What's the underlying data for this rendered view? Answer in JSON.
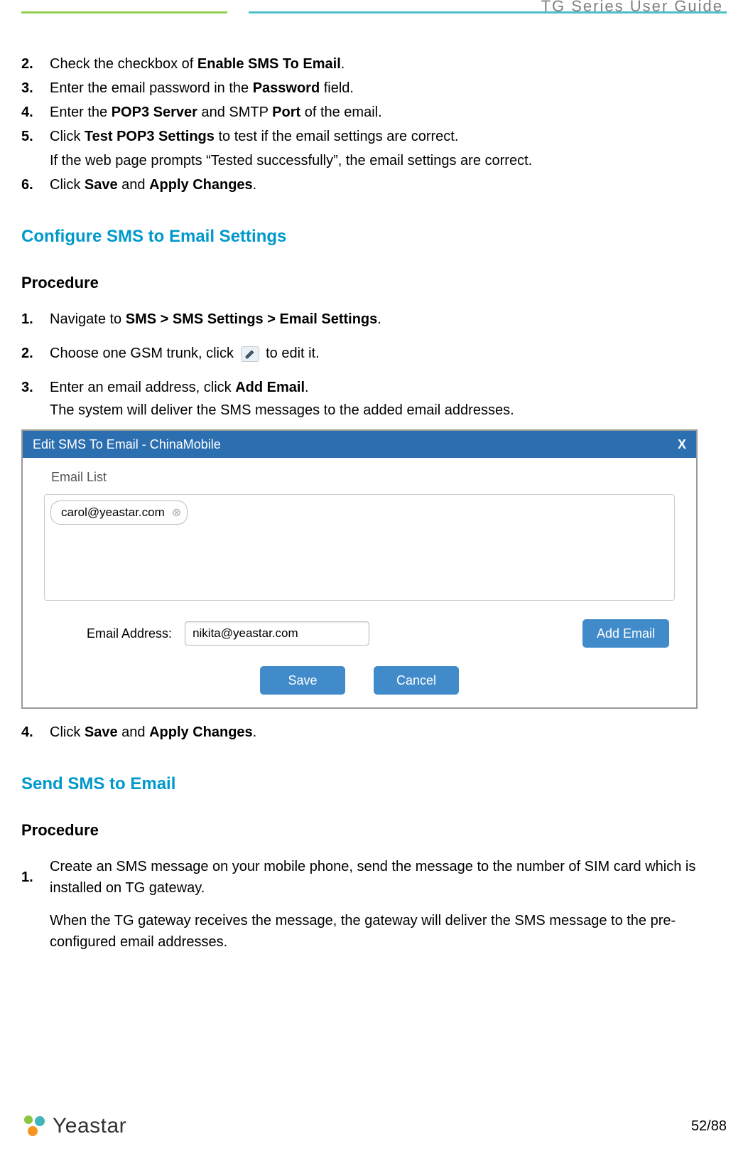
{
  "header": {
    "title": "TG  Series  User  Guide"
  },
  "list1": {
    "item2_a": "Check the checkbox of ",
    "item2_b": "Enable SMS To Email",
    "item2_c": ".",
    "item3_a": "Enter the email password in the ",
    "item3_b": "Password",
    "item3_c": " field.",
    "item4_a": "Enter the ",
    "item4_b": "POP3 Server",
    "item4_c": " and SMTP ",
    "item4_d": "Port",
    "item4_e": " of the email.",
    "item5_a": "Click ",
    "item5_b": "Test POP3 Settings",
    "item5_c": " to test if the email settings are correct.",
    "item5_note": "If the web page prompts “Tested successfully”, the email settings are correct.",
    "item6_a": "Click ",
    "item6_b": "Save",
    "item6_c": " and ",
    "item6_d": "Apply Changes",
    "item6_e": "."
  },
  "nums": {
    "n2": "2.",
    "n3": "3.",
    "n4": "4.",
    "n5": "5.",
    "n6": "6."
  },
  "section1": {
    "title": "Configure SMS to Email Settings",
    "procedure": "Procedure",
    "p1_a": "Navigate to ",
    "p1_b": "SMS > SMS Settings > Email Settings",
    "p1_c": ".",
    "p2_a": "Choose one GSM trunk, click",
    "p2_b": " to edit it.",
    "p3_a": "Enter an email address, click ",
    "p3_b": "Add Email",
    "p3_c": ".",
    "p3_note": "The system will deliver the SMS messages to the added email addresses.",
    "p4_a": "Click ",
    "p4_b": "Save",
    "p4_c": " and ",
    "p4_d": "Apply Changes",
    "p4_e": "."
  },
  "procnums": {
    "n1": "1.",
    "n2": "2.",
    "n3": "3.",
    "n4": "4."
  },
  "dialog": {
    "title": "Edit SMS To Email - ChinaMobile",
    "close": "X",
    "email_list_label": "Email List",
    "pill_value": "carol@yeastar.com",
    "pill_remove": "⊗",
    "email_addr_label": "Email Address:",
    "email_addr_value": "nikita@yeastar.com",
    "add_email": "Add Email",
    "save": "Save",
    "cancel": "Cancel"
  },
  "section2": {
    "title": "Send SMS to Email",
    "procedure": "Procedure",
    "p1_a": "Create an SMS message on your mobile phone, send the message to the number of SIM card which is installed on TG gateway.",
    "p1_b": "When the TG gateway receives the message, the gateway will deliver the SMS message to the pre-configured email addresses."
  },
  "footer": {
    "logo_text": "Yeastar",
    "page": "52/88"
  }
}
